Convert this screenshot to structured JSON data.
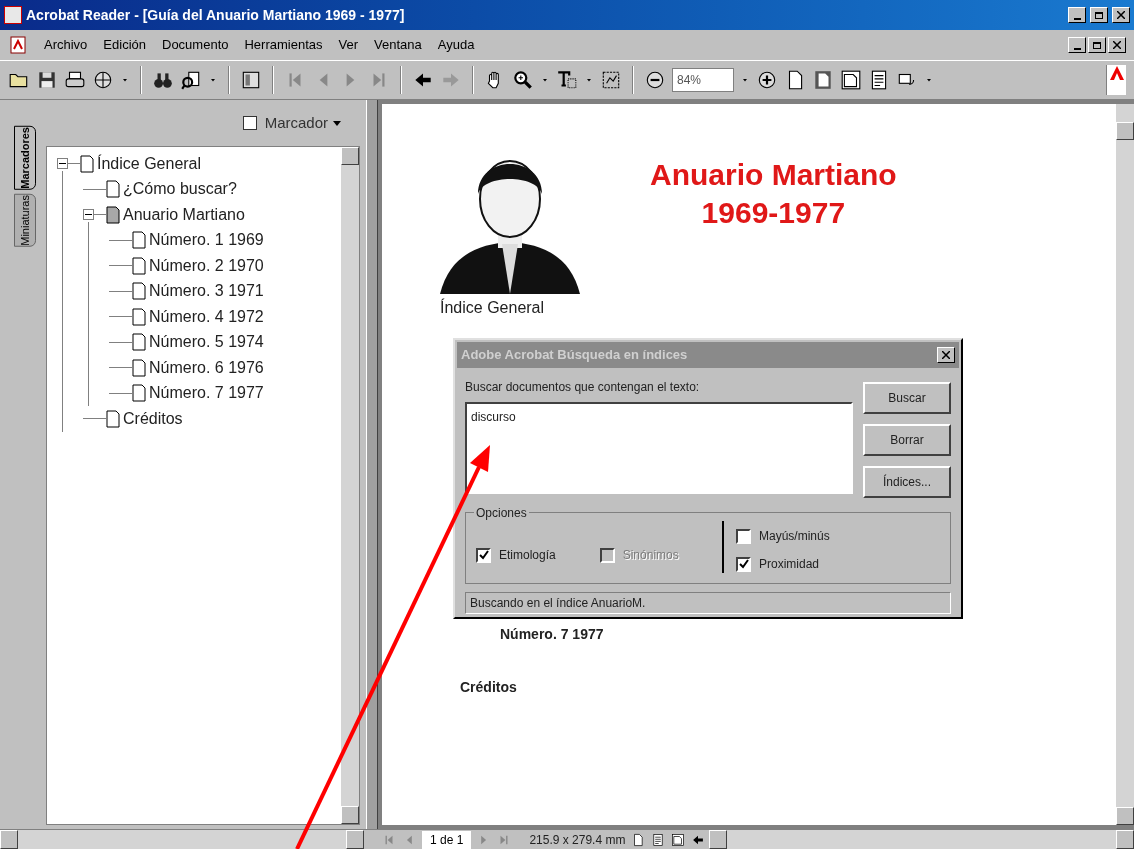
{
  "window": {
    "title": "Acrobat Reader - [Guía del Anuario Martiano 1969 - 1977]"
  },
  "menu": [
    "Archivo",
    "Edición",
    "Documento",
    "Herramientas",
    "Ver",
    "Ventana",
    "Ayuda"
  ],
  "toolbar": {
    "zoom": "84%"
  },
  "side_tabs": [
    {
      "label": "Marcadores",
      "selected": true
    },
    {
      "label": "Miniaturas",
      "selected": false
    }
  ],
  "bookmarks": {
    "menu": "Marcador",
    "tree": [
      {
        "label": "Índice General",
        "expanded": true,
        "selected": false,
        "children": [
          {
            "label": "¿Cómo buscar?",
            "selected": false
          },
          {
            "label": "Anuario Martiano",
            "expanded": true,
            "selected": true,
            "children": [
              {
                "label": "Número. 1 1969",
                "selected": false
              },
              {
                "label": "Número. 2 1970",
                "selected": false
              },
              {
                "label": "Número. 3 1971",
                "selected": false
              },
              {
                "label": "Número. 4 1972",
                "selected": false
              },
              {
                "label": "Número. 5 1974",
                "selected": false
              },
              {
                "label": "Número. 6 1976",
                "selected": false
              },
              {
                "label": "Número. 7 1977",
                "selected": false
              }
            ]
          },
          {
            "label": "Créditos",
            "selected": false
          }
        ]
      }
    ]
  },
  "document": {
    "title": "Anuario Martiano",
    "subtitle": "1969-1977",
    "heading": "Índice General",
    "entries": [
      "Número. 7 1977",
      "Créditos"
    ]
  },
  "dialog": {
    "title": "Adobe Acrobat Búsqueda en índices",
    "prompt": "Buscar documentos que contengan el texto:",
    "query": "discurso",
    "buttons": [
      "Buscar",
      "Borrar",
      "Índices..."
    ],
    "options_label": "Opciones",
    "options_left": [
      {
        "label": "Etimología",
        "checked": true,
        "disabled": false
      },
      {
        "label": "Sinónimos",
        "checked": false,
        "disabled": true
      }
    ],
    "options_right": [
      {
        "label": "Mayús/minús",
        "checked": false,
        "disabled": false
      },
      {
        "label": "Proximidad",
        "checked": true,
        "disabled": false
      }
    ],
    "status": "Buscando en el índice AnuarioM."
  },
  "status_bar": {
    "page": "1 de 1",
    "size": "215.9 x 279.4 mm"
  }
}
